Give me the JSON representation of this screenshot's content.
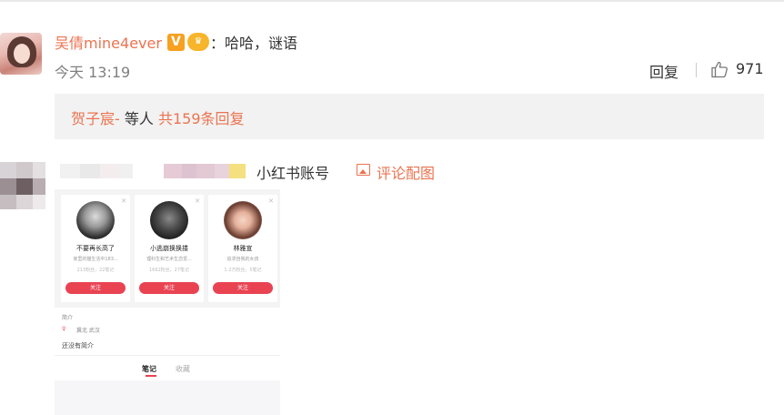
{
  "colors": {
    "accent": "#eb7350",
    "text": "#333333",
    "muted": "#808080",
    "subbox": "#f2f2f2",
    "follow_red": "#e94352"
  },
  "comment1": {
    "username": "吴倩mine4ever",
    "badge_v": "V",
    "badge_vip_icon": "vip-badge-icon",
    "colon": "：",
    "text": "哈哈，谜语",
    "time": "今天 13:19",
    "reply_label": "回复",
    "like_icon": "thumbs-up-icon",
    "like_count": "971",
    "sub_reply": {
      "user": "贺子宸-",
      "text": "等人",
      "count_label": "共159条回复"
    }
  },
  "comment2": {
    "topic": "小红书账号",
    "pic_icon": "image-icon",
    "link_label": "评论配图",
    "screenshot": {
      "cards": [
        {
          "name": "不要再长高了",
          "desc": "家里的猫生活中183...",
          "stats": "213粉丝，22笔记",
          "follow": "关注"
        },
        {
          "name": "小逃崩换换搂",
          "desc": "理科生和艺术生恋爱...",
          "stats": "1662粉丝，27笔记",
          "follow": "关注"
        },
        {
          "name": "林雅宣",
          "desc": "追求自我的女孩",
          "stats": "1.2万粉丝，5笔记",
          "follow": "关注"
        }
      ],
      "section_label": "简介",
      "location": "冀北 武汉",
      "bio": "还没有简介",
      "tab_notes": "笔记",
      "tab_collect": "收藏"
    }
  }
}
